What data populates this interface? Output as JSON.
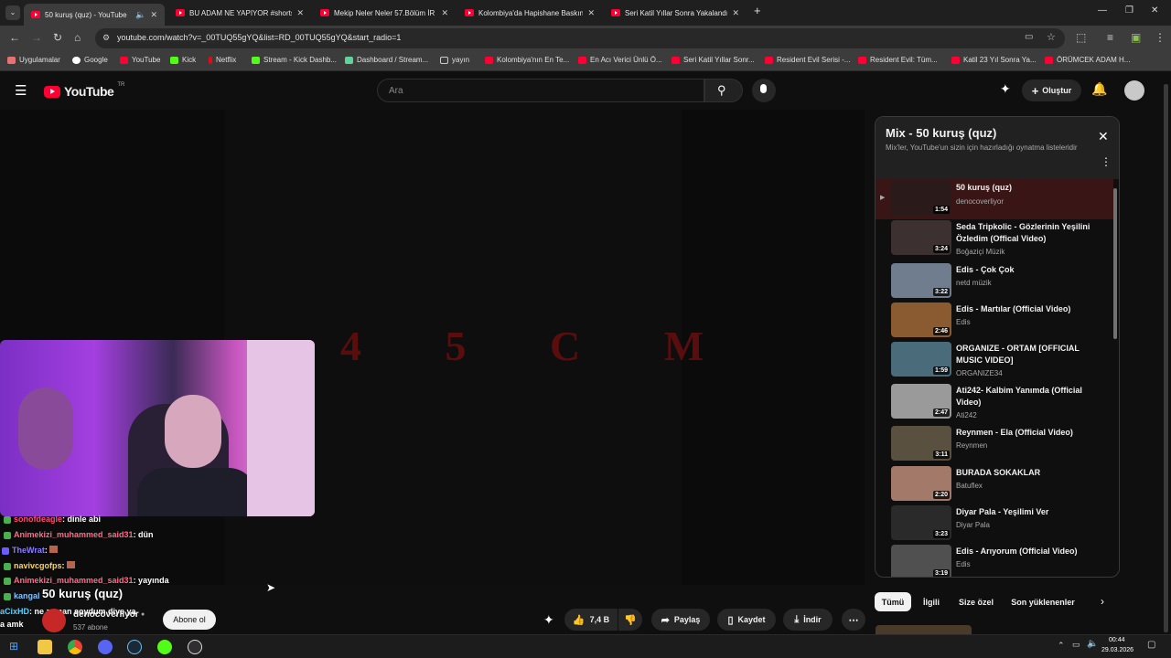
{
  "browser": {
    "tabs": [
      {
        "title": "50 kuruş (quz) - YouTube",
        "active": true
      },
      {
        "title": "BU ADAM NE YAPIYOR #shorts"
      },
      {
        "title": "Mekip Neler Neler 57.Bölüm İR"
      },
      {
        "title": "Kolombiya'da Hapishane Baskın"
      },
      {
        "title": "Seri Katil Yıllar Sonra Yakalandı"
      }
    ],
    "url": "youtube.com/watch?v=_00TUQ55gYQ&list=RD_00TUQ55gYQ&start_radio=1",
    "bookmarks": [
      "Uygulamalar",
      "Google",
      "YouTube",
      "Kick",
      "Netflix",
      "Stream - Kick Dashb...",
      "Dashboard / Stream...",
      "yayın",
      "Kolombiya'nın En Te...",
      "En Acı Verici Ünlü Ö...",
      "Seri Katil Yıllar Sonr...",
      "Resident Evil Serisi -...",
      "Resident Evil: Tüm...",
      "Katil 23 Yıl Sonra Ya...",
      "ÖRÜMCEK ADAM H..."
    ]
  },
  "youtube": {
    "logo_text": "YouTube",
    "region": "TR",
    "search_placeholder": "Ara",
    "create_label": "Oluştur"
  },
  "video": {
    "overlay_text": "4 5 C M",
    "title": "50 kuruş (quz)",
    "channel": "denocoverliyor",
    "subscribers": "537 abone",
    "subscribe_label": "Abone ol",
    "likes": "7,4 B",
    "share_label": "Paylaş",
    "save_label": "Kaydet",
    "download_label": "İndir"
  },
  "chat": [
    {
      "user": "sonofdeagle",
      "msg": ": dinle abi",
      "color": "#ff4d6d"
    },
    {
      "user": "Animekizi_muhammed_said31",
      "msg": ": dün",
      "color": "#ff6b8a"
    },
    {
      "user": "TheWrat",
      "msg": ":",
      "color": "#8a7dff"
    },
    {
      "user": "navivcgofps",
      "msg": ":",
      "color": "#ffd54f"
    },
    {
      "user": "Animekizi_muhammed_said31",
      "msg": ": yayında",
      "color": "#ff6b8a"
    },
    {
      "user": "kangal",
      "msg": "",
      "color": "#7fc4ff"
    },
    {
      "user": "aCixHD",
      "msg": ": ne zaman soydum diye ya",
      "color": "#5ad1ff"
    },
    {
      "user": "",
      "msg": "a amk",
      "color": "#fff"
    }
  ],
  "playlist": {
    "title": "Mix - 50 kuruş (quz)",
    "subtitle": "Mix'ler, YouTube'un sizin için hazırladığı oynatma listeleridir",
    "items": [
      {
        "title": "50 kuruş (quz)",
        "channel": "denocoverliyor",
        "duration": "1:54",
        "color": "#2a1a1a"
      },
      {
        "title": "Seda Tripkolic - Gözlerinin Yeşilini Özledim (Offical Video)",
        "channel": "Boğaziçi Müzik",
        "duration": "3:24",
        "color": "#3d3030"
      },
      {
        "title": "Edis - Çok Çok",
        "channel": "netd müzik",
        "duration": "3:22",
        "color": "#6f7d8e"
      },
      {
        "title": "Edis - Martılar (Official Video)",
        "channel": "Edis",
        "duration": "2:46",
        "color": "#8a5a30"
      },
      {
        "title": "ORGANIZE - ORTAM [OFFICIAL MUSIC VIDEO]",
        "channel": "ORGANIZE34",
        "duration": "1:59",
        "color": "#4a6b7a"
      },
      {
        "title": "Ati242- Kalbim Yanımda (Official Video)",
        "channel": "Ati242",
        "duration": "2:47",
        "color": "#9a9a9a"
      },
      {
        "title": "Reynmen - Ela (Official Video)",
        "channel": "Reynmen",
        "duration": "3:11",
        "color": "#5a5040"
      },
      {
        "title": "BURADA SOKAKLAR",
        "channel": "Batuflex",
        "duration": "2:20",
        "color": "#a37a6a"
      },
      {
        "title": "Diyar Pala - Yeşilimi Ver",
        "channel": "Diyar Pala",
        "duration": "3:23",
        "color": "#2a2a2a"
      },
      {
        "title": "Edis - Arıyorum (Official Video)",
        "channel": "Edis",
        "duration": "3:19",
        "color": "#505050"
      }
    ]
  },
  "chips": [
    "Tümü",
    "İlgili",
    "Size özel",
    "Son yüklenenler"
  ],
  "taskbar": {
    "time": "00:44",
    "date": "29.03.2026"
  }
}
